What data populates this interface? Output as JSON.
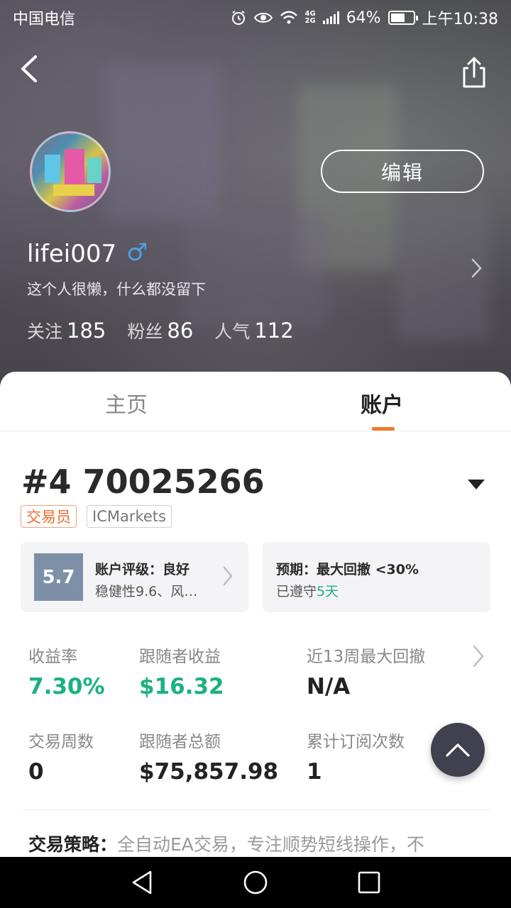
{
  "status_bar": {
    "carrier": "中国电信",
    "network_top": "4G",
    "network_bottom": "2G",
    "battery": "64%",
    "battery_level": 0.64,
    "time": "上午10:38",
    "icons": [
      "alarm-icon",
      "eye-icon",
      "wifi-icon",
      "signal-icon",
      "battery-icon"
    ]
  },
  "header": {
    "back_icon": "back-arrow-icon",
    "share_icon": "share-icon"
  },
  "profile": {
    "edit_label": "编辑",
    "username": "lifei007",
    "gender_symbol": "♂",
    "gender_color": "#4aa0e8",
    "bio": "这个人很懒，什么都没留下",
    "stats": [
      {
        "label": "关注",
        "value": "185"
      },
      {
        "label": "粉丝",
        "value": "86"
      },
      {
        "label": "人气",
        "value": "112"
      }
    ]
  },
  "tabs": {
    "items": [
      {
        "label": "主页",
        "active": false
      },
      {
        "label": "账户",
        "active": true
      }
    ],
    "accent_color": "#f07a28"
  },
  "account": {
    "title": "#4 70025266",
    "role_badge": "交易员",
    "broker_badge": "ICMarkets",
    "rating_score": "5.7",
    "rating_title": "账户评级：良好",
    "rating_detail": "稳健性9.6、风…",
    "expect_title": "预期：最大回撤 <30%",
    "expect_detail_prefix": "已遵守",
    "expect_detail_value": "5天"
  },
  "metrics": [
    {
      "label": "收益率",
      "value": "7.30%",
      "highlight": true
    },
    {
      "label": "跟随者收益",
      "value": "$16.32",
      "highlight": true
    },
    {
      "label": "近13周最大回撤",
      "value": "N/A",
      "highlight": false
    },
    {
      "label": "交易周数",
      "value": "0",
      "highlight": false
    },
    {
      "label": "跟随者总额",
      "value": "$75,857.98",
      "highlight": false
    },
    {
      "label": "累计订阅次数",
      "value": "1",
      "highlight": false
    }
  ],
  "strategy": {
    "label": "交易策略：",
    "text": "全自动EA交易，专注顺势短线操作，不"
  },
  "colors": {
    "positive": "#1bb082",
    "fab_bg": "#40404e",
    "rating_box": "#7e8fa8"
  }
}
